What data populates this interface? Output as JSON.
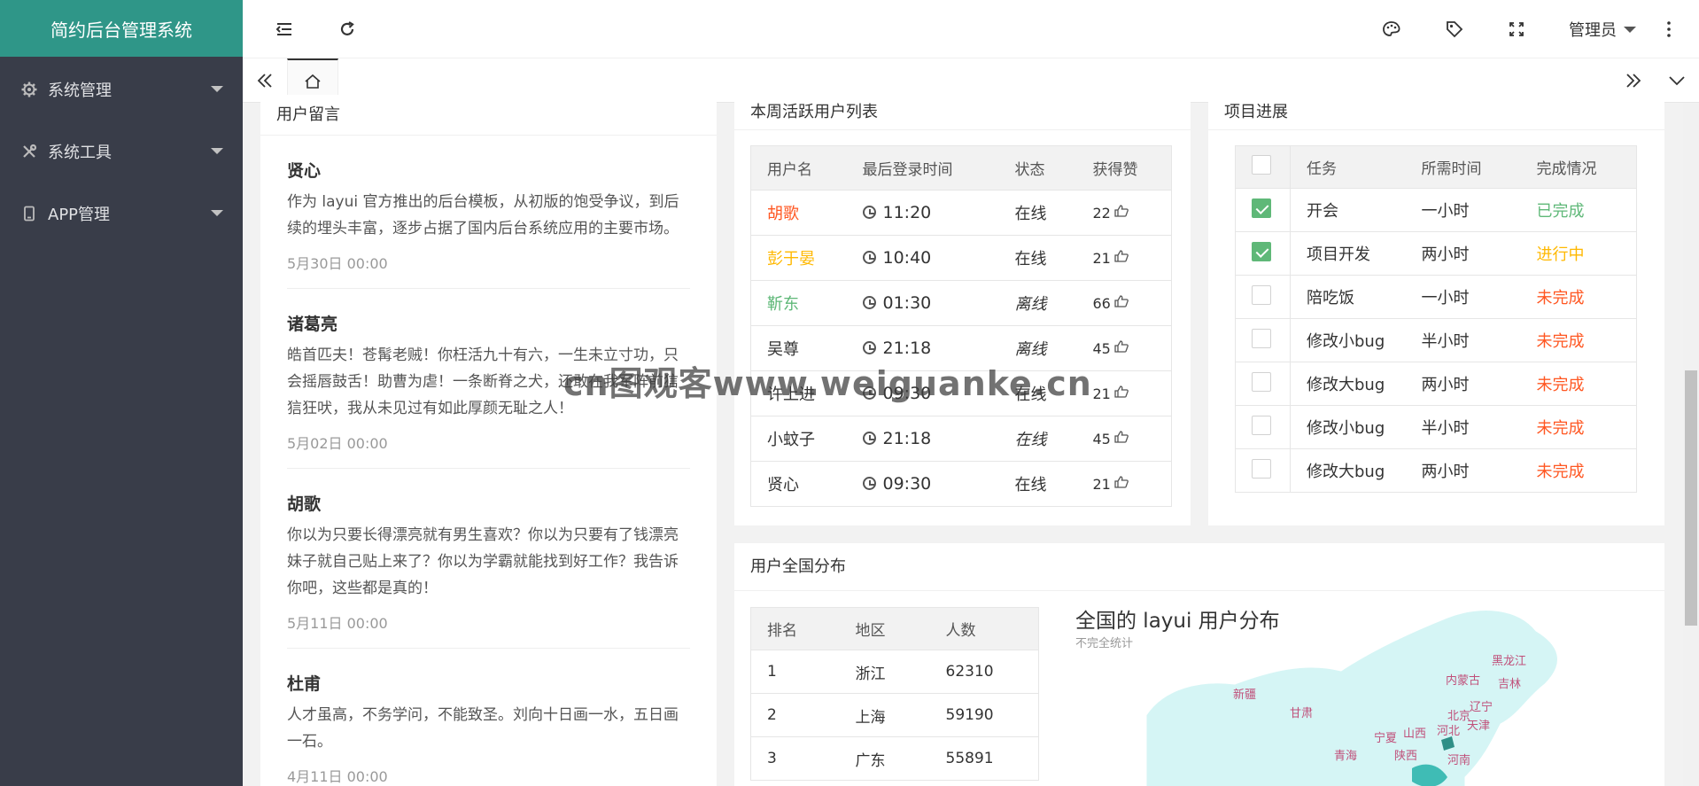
{
  "app": {
    "title": "简约后台管理系统"
  },
  "sidebar": {
    "items": [
      {
        "label": "系统管理",
        "icon": "gear-icon"
      },
      {
        "label": "系统工具",
        "icon": "tools-icon"
      },
      {
        "label": "APP管理",
        "icon": "mobile-icon"
      }
    ]
  },
  "topbar": {
    "admin_label": "管理员"
  },
  "messages": {
    "title": "用户留言",
    "items": [
      {
        "name": "贤心",
        "text": "作为 layui 官方推出的后台模板，从初版的饱受争议，到后续的埋头丰富，逐步占据了国内后台系统应用的主要市场。",
        "time": "5月30日 00:00"
      },
      {
        "name": "诸葛亮",
        "text": "皓首匹夫！苍髯老贼！你枉活九十有六，一生未立寸功，只会摇唇鼓舌！助曹为虐！一条断脊之犬，还敢在我军阵前狺狺狂吠，我从未见过有如此厚颜无耻之人！",
        "time": "5月02日 00:00"
      },
      {
        "name": "胡歌",
        "text": "你以为只要长得漂亮就有男生喜欢？你以为只要有了钱漂亮妹子就自己贴上来了？你以为学霸就能找到好工作？我告诉你吧，这些都是真的！",
        "time": "5月11日 00:00"
      },
      {
        "name": "杜甫",
        "text": "人才虽高，不务学问，不能致圣。刘向十日画一水，五日画一石。",
        "time": "4月11日 00:00"
      }
    ]
  },
  "active_users": {
    "title": "本周活跃用户列表",
    "headers": [
      "用户名",
      "最后登录时间",
      "状态",
      "获得赞"
    ],
    "rows": [
      {
        "name": "胡歌",
        "color": "#ff5722",
        "time": "11:20",
        "status": "在线",
        "italic": false,
        "likes": "22"
      },
      {
        "name": "彭于晏",
        "color": "#ffb800",
        "time": "10:40",
        "status": "在线",
        "italic": false,
        "likes": "21"
      },
      {
        "name": "靳东",
        "color": "#5fb878",
        "time": "01:30",
        "status": "离线",
        "italic": true,
        "likes": "66"
      },
      {
        "name": "吴尊",
        "color": "#333333",
        "time": "21:18",
        "status": "离线",
        "italic": true,
        "likes": "45"
      },
      {
        "name": "许上进",
        "color": "#333333",
        "time": "09:30",
        "status": "在线",
        "italic": false,
        "likes": "21"
      },
      {
        "name": "小蚊子",
        "color": "#333333",
        "time": "21:18",
        "status": "在线",
        "italic": true,
        "likes": "45"
      },
      {
        "name": "贤心",
        "color": "#333333",
        "time": "09:30",
        "status": "在线",
        "italic": false,
        "likes": "21"
      }
    ]
  },
  "progress": {
    "title": "项目进展",
    "headers": [
      "任务",
      "所需时间",
      "完成情况"
    ],
    "rows": [
      {
        "checked": true,
        "task": "开会",
        "time": "一小时",
        "status": "已完成",
        "color": "#5fb878"
      },
      {
        "checked": true,
        "task": "项目开发",
        "time": "两小时",
        "status": "进行中",
        "color": "#ffb800"
      },
      {
        "checked": false,
        "task": "陪吃饭",
        "time": "一小时",
        "status": "未完成",
        "color": "#ff5722"
      },
      {
        "checked": false,
        "task": "修改小bug",
        "time": "半小时",
        "status": "未完成",
        "color": "#ff5722"
      },
      {
        "checked": false,
        "task": "修改大bug",
        "time": "两小时",
        "status": "未完成",
        "color": "#ff5722"
      },
      {
        "checked": false,
        "task": "修改小bug",
        "time": "半小时",
        "status": "未完成",
        "color": "#ff5722"
      },
      {
        "checked": false,
        "task": "修改大bug",
        "time": "两小时",
        "status": "未完成",
        "color": "#ff5722"
      }
    ]
  },
  "distribution": {
    "title": "用户全国分布",
    "headers": [
      "排名",
      "地区",
      "人数"
    ],
    "rows": [
      {
        "rank": "1",
        "region": "浙江",
        "count": "62310"
      },
      {
        "rank": "2",
        "region": "上海",
        "count": "59190"
      },
      {
        "rank": "3",
        "region": "广东",
        "count": "55891"
      }
    ],
    "map_title": "全国的 layui 用户分布",
    "map_subtitle": "不完全统计",
    "provinces": [
      "黑龙江",
      "吉林",
      "辽宁",
      "内蒙古",
      "北京",
      "天津",
      "河北",
      "山西",
      "宁夏",
      "陕西",
      "新疆",
      "甘肃",
      "青海",
      "河南"
    ]
  },
  "watermark": "cn图观客www.weiguanke.cn"
}
